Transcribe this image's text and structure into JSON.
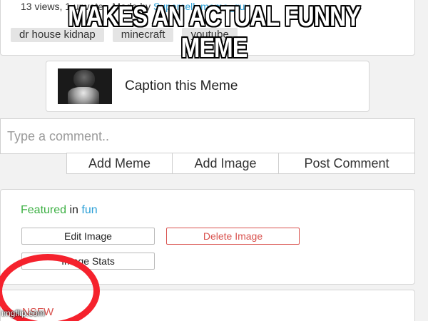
{
  "meme": {
    "top_caption": "MAKES AN ACTUAL FUNNY MEME",
    "watermark": "imgflip.com"
  },
  "stats": {
    "views": "13 views",
    "upvotes": "1 upvote",
    "made_by_label": "Made by",
    "author": "Supercell_meme_guy"
  },
  "tags": [
    "dr house kidnap",
    "minecraft",
    "youtube"
  ],
  "caption_box": {
    "label": "Caption this Meme"
  },
  "comment": {
    "placeholder": "Type a comment..",
    "add_meme": "Add Meme",
    "add_image": "Add Image",
    "post_comment": "Post Comment"
  },
  "featured": {
    "prefix": "Featured",
    "joiner": "in",
    "stream": "fun"
  },
  "actions": {
    "edit_image": "Edit Image",
    "delete_image": "Delete Image",
    "image_stats": "Image Stats"
  },
  "nsfw": {
    "label": "NSFW"
  },
  "colors": {
    "link": "#2a9fd6",
    "featured_green": "#3cb043",
    "delete_red": "#d9534f",
    "highlight_circle": "#f5222d"
  }
}
